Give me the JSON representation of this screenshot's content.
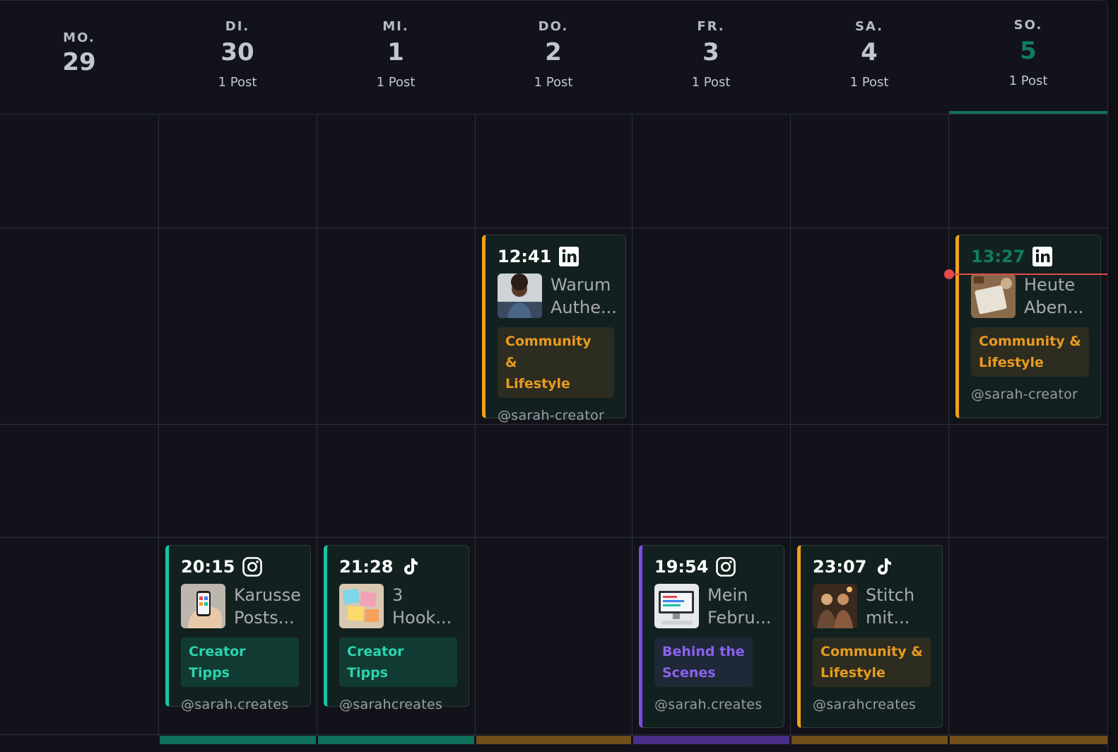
{
  "days": [
    {
      "dow": "MO.",
      "num": "29",
      "count": ""
    },
    {
      "dow": "DI.",
      "num": "30",
      "count": "1 Post"
    },
    {
      "dow": "MI.",
      "num": "1",
      "count": "1 Post"
    },
    {
      "dow": "DO.",
      "num": "2",
      "count": "1 Post"
    },
    {
      "dow": "FR.",
      "num": "3",
      "count": "1 Post"
    },
    {
      "dow": "SA.",
      "num": "4",
      "count": "1 Post"
    },
    {
      "dow": "SO.",
      "num": "5",
      "count": "1 Post"
    }
  ],
  "posts": [
    {
      "time": "12:41",
      "platform": "linkedin-icon",
      "title": "Warum\nAuthe...",
      "tag": "Community &\nLifestyle",
      "handle": "@sarah-creator"
    },
    {
      "time": "13:27",
      "platform": "linkedin-icon",
      "title": "Heute\nAben...",
      "tag": "Community &\nLifestyle",
      "handle": "@sarah-creator"
    },
    {
      "time": "20:15",
      "platform": "instagram-icon",
      "title": "Karusse\nPosts...",
      "tag": "Creator Tipps",
      "handle": "@sarah.creates"
    },
    {
      "time": "21:28",
      "platform": "tiktok-icon",
      "title": "3\nHook...",
      "tag": "Creator Tipps",
      "handle": "@sarahcreates"
    },
    {
      "time": "19:54",
      "platform": "instagram-icon",
      "title": "Mein\nFebru...",
      "tag": "Behind the\nScenes",
      "handle": "@sarah.creates"
    },
    {
      "time": "23:07",
      "platform": "tiktok-icon",
      "title": "Stitch\nmit...",
      "tag": "Community &\nLifestyle",
      "handle": "@sarahcreates"
    }
  ],
  "colors": {
    "teal": "#16c6a2",
    "orange": "#f0a020",
    "purple": "#7c4de6",
    "today": "#127a63",
    "now": "#e5484d"
  }
}
